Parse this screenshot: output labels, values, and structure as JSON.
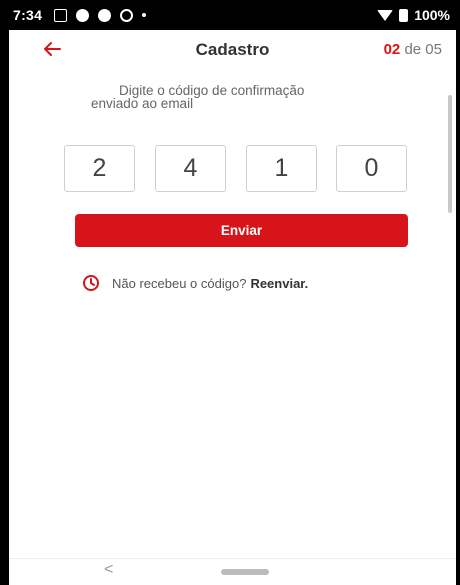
{
  "status_bar": {
    "time": "7:34",
    "battery": "100%"
  },
  "header": {
    "back_icon": "arrow-left-icon",
    "title": "Cadastro",
    "step_current": "02",
    "step_rest": " de 05"
  },
  "instruction": {
    "line1": "Digite o código de confirmação",
    "line2": "enviado ao email"
  },
  "code": {
    "digits": [
      "2",
      "4",
      "1",
      "0"
    ]
  },
  "send_button": {
    "label": "Enviar"
  },
  "resend": {
    "icon": "clock-icon",
    "prompt": "Não recebeu o código?",
    "link": "Reenviar."
  },
  "nav_bar": {
    "back_glyph": "<"
  },
  "colors": {
    "accent": "#d7141a",
    "text": "#333333",
    "border": "#cfcfcf"
  }
}
